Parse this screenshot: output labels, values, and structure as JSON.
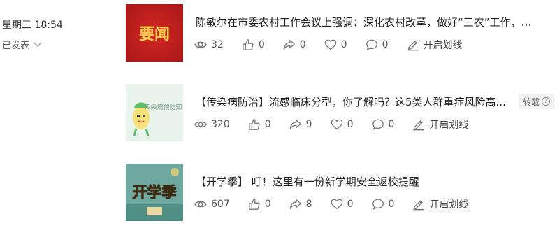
{
  "meta": {
    "time": "星期三 18:54",
    "status": "已发表"
  },
  "articles": [
    {
      "thumb_text": "要闻",
      "title": "陈敏尔在市委农村工作会议上强调：深化农村改革，做好“三农”工作，…",
      "tag": "",
      "views": "32",
      "likes": "0",
      "shares": "0",
      "favorites": "0",
      "comments": "0",
      "highlight_label": "开启划线"
    },
    {
      "thumb_text": "传染病预防知识",
      "title": "【传染病防治】流感临床分型，你了解吗？这5类人群重症风险高...",
      "tag": "转载",
      "views": "320",
      "likes": "0",
      "shares": "9",
      "favorites": "0",
      "comments": "0",
      "highlight_label": "开启划线"
    },
    {
      "thumb_text": "开学季",
      "title": "【开学季】 叮！这里有一份新学期安全返校提醒",
      "tag": "",
      "views": "607",
      "likes": "0",
      "shares": "8",
      "favorites": "0",
      "comments": "0",
      "highlight_label": "开启划线"
    }
  ],
  "colors": {
    "news_thumb_bg": "#c81e1e",
    "news_thumb_text": "#ffd24a",
    "health_thumb_bg": "#e9f4ec",
    "school_thumb_bg": "#6fa8a0",
    "school_thumb_text": "#f4c430"
  }
}
